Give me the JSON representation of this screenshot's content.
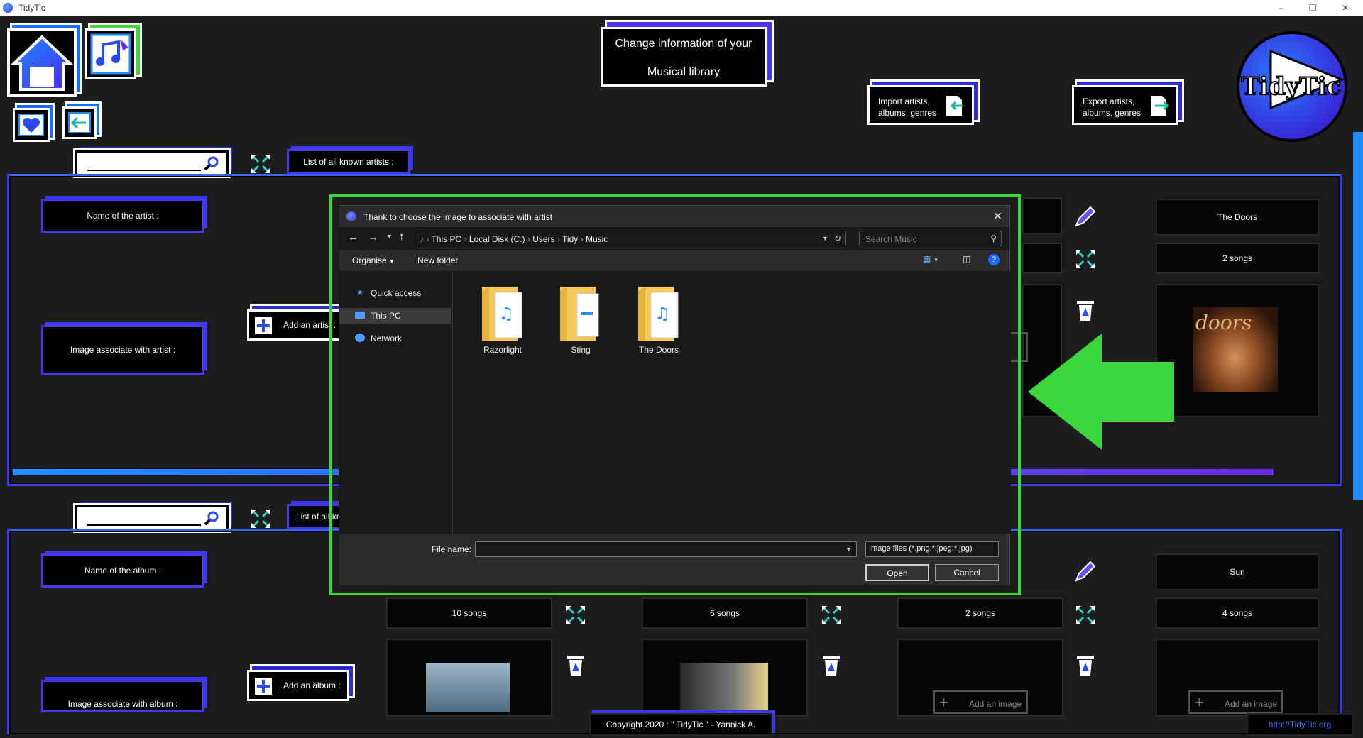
{
  "window": {
    "title": "TidyTic"
  },
  "header": {
    "banner_line1": "Change information of your",
    "banner_line2": "Musical library",
    "import_label_1": "Import artists,",
    "import_label_2": "albums, genres",
    "export_label_1": "Export artists,",
    "export_label_2": "albums, genres",
    "logo_text": "TidyTic"
  },
  "artists": {
    "list_label": "List of all known artists :",
    "name_label": "Name of the artist :",
    "image_label": "Image associate with artist :",
    "add_label": "Add an artist :",
    "card_name": "The Doors",
    "card_songs": "2 songs"
  },
  "albums": {
    "list_label": "List of all known albums :",
    "name_label": "Name of the album :",
    "image_label": "Image associate with album :",
    "add_label": "Add an album :",
    "cards": [
      {
        "songs": "10 songs"
      },
      {
        "songs": "6 songs"
      },
      {
        "songs": "2 songs",
        "add_image": "Add an image"
      },
      {
        "name": "Sun",
        "songs": "4 songs",
        "add_image": "Add an image"
      }
    ]
  },
  "dialog": {
    "title": "Thank to choose the image to associate with artist",
    "breadcrumb": [
      "This PC",
      "Local Disk (C:)",
      "Users",
      "Tidy",
      "Music"
    ],
    "search_placeholder": "Search Music",
    "organise": "Organise",
    "new_folder": "New folder",
    "nav": [
      "Quick access",
      "This PC",
      "Network"
    ],
    "folders": [
      "Razorlight",
      "Sting",
      "The Doors"
    ],
    "file_name_label": "File name:",
    "file_name_value": "",
    "file_type": "Image files (*.png;*.jpeg;*.jpg)",
    "open_label": "Open",
    "cancel_label": "Cancel"
  },
  "footer": {
    "copyright": "Copyright 2020 : \" TidyTic \" - Yannick A.",
    "url": "http://TidyTic.org"
  },
  "colors": {
    "accent_blue": "#3a3af0",
    "highlight_green": "#3bd63b"
  }
}
